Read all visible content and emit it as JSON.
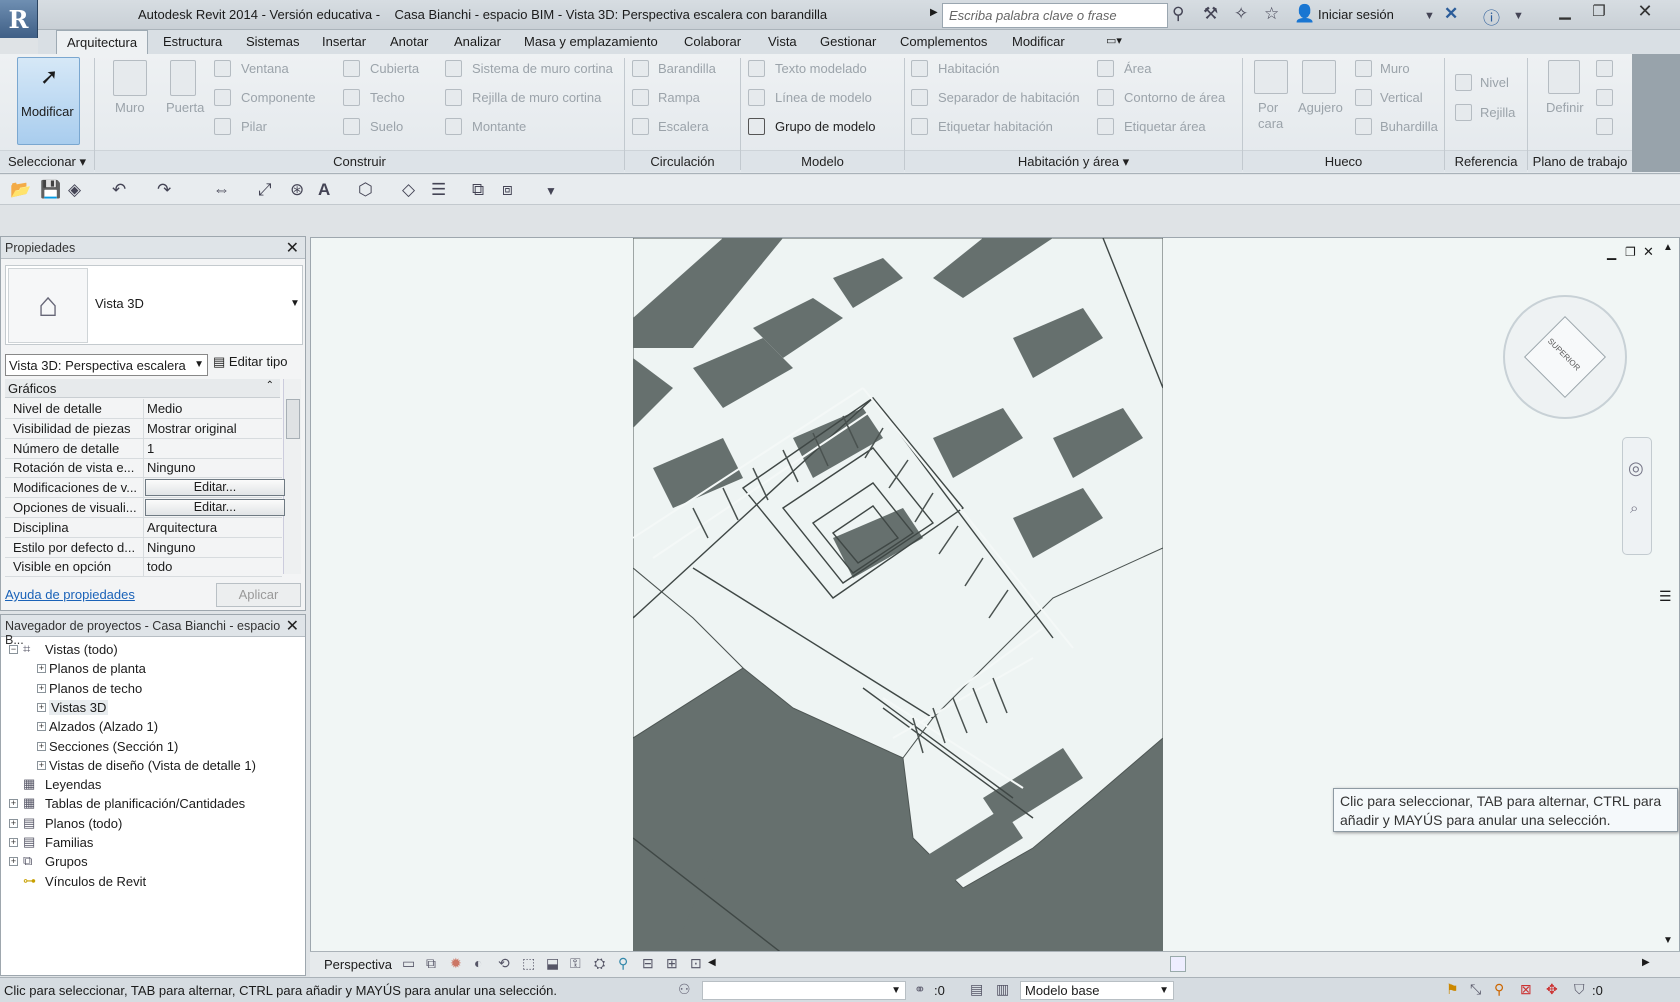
{
  "title": {
    "app": "Autodesk Revit 2014 - Versión educativa -",
    "doc": "Casa Bianchi - espacio BIM - Vista 3D: Perspectiva escalera con barandilla"
  },
  "infocenter": {
    "search_placeholder": "Escriba palabra clave o frase",
    "signin": "Iniciar sesión"
  },
  "tabs": [
    "Arquitectura",
    "Estructura",
    "Sistemas",
    "Insertar",
    "Anotar",
    "Analizar",
    "Masa y emplazamiento",
    "Colaborar",
    "Vista",
    "Gestionar",
    "Complementos",
    "Modificar"
  ],
  "ribbon": {
    "modify": "Modificar",
    "select": "Seleccionar",
    "build": {
      "muro": "Muro",
      "puerta": "Puerta",
      "ventana": "Ventana",
      "componente": "Componente",
      "pilar": "Pilar",
      "cubierta": "Cubierta",
      "techo": "Techo",
      "suelo": "Suelo",
      "sistema_muro": "Sistema de muro cortina",
      "rejilla_muro": "Rejilla de muro cortina",
      "montante": "Montante"
    },
    "circ": {
      "barandilla": "Barandilla",
      "rampa": "Rampa",
      "escalera": "Escalera"
    },
    "model": {
      "texto": "Texto modelado",
      "linea": "Línea de modelo",
      "grupo": "Grupo de modelo"
    },
    "room": {
      "habitacion": "Habitación",
      "separador": "Separador de habitación",
      "etiquetar_hab": "Etiquetar habitación",
      "area": "Área",
      "contorno": "Contorno de área",
      "etiquetar_area": "Etiquetar área"
    },
    "hueco": {
      "por_cara": "Por cara",
      "agujero": "Agujero",
      "muro": "Muro",
      "vertical": "Vertical",
      "buhardilla": "Buhardilla"
    },
    "ref": {
      "nivel": "Nivel",
      "rejilla": "Rejilla"
    },
    "plano": {
      "definir": "Definir"
    },
    "groups": [
      "Construir",
      "Circulación",
      "Modelo",
      "Habitación y área",
      "Hueco",
      "Referencia",
      "Plano de trabajo"
    ]
  },
  "properties": {
    "title": "Propiedades",
    "type_name": "Vista 3D",
    "instance": "Vista 3D: Perspectiva escalera",
    "edit_type": "Editar tipo",
    "section": "Gráficos",
    "rows": [
      {
        "k": "Nivel de detalle",
        "v": "Medio"
      },
      {
        "k": "Visibilidad de piezas",
        "v": "Mostrar original"
      },
      {
        "k": "Número de detalle",
        "v": "1"
      },
      {
        "k": "Rotación de vista e...",
        "v": "Ninguno"
      },
      {
        "k": "Modificaciones de v...",
        "v": "Editar..."
      },
      {
        "k": "Opciones de visuali...",
        "v": "Editar..."
      },
      {
        "k": "Disciplina",
        "v": "Arquitectura"
      },
      {
        "k": "Estilo por defecto d...",
        "v": "Ninguno"
      },
      {
        "k": "Visible en opción",
        "v": "todo"
      }
    ],
    "help": "Ayuda de propiedades",
    "apply": "Aplicar"
  },
  "browser": {
    "title": "Navegador de proyectos - Casa Bianchi - espacio B...",
    "nodes": [
      "Vistas (todo)",
      "Planos de planta",
      "Planos de techo",
      "Vistas 3D",
      "Alzados (Alzado 1)",
      "Secciones (Sección  1)",
      "Vistas de diseño (Vista de detalle 1)",
      "Leyendas",
      "Tablas de planificación/Cantidades",
      "Planos (todo)",
      "Familias",
      "Grupos",
      "Vínculos de Revit"
    ]
  },
  "view": {
    "mode": "Perspectiva",
    "cube": "SUPERIOR",
    "tooltip": "Clic para seleccionar, TAB para alternar, CTRL para añadir y MAYÚS para anular una selección."
  },
  "status": {
    "text": "Clic para seleccionar, TAB para alternar, CTRL para añadir y MAYÚS para anular una selección.",
    "zero": ":0",
    "model": "Modelo base",
    "filter": ":0"
  }
}
